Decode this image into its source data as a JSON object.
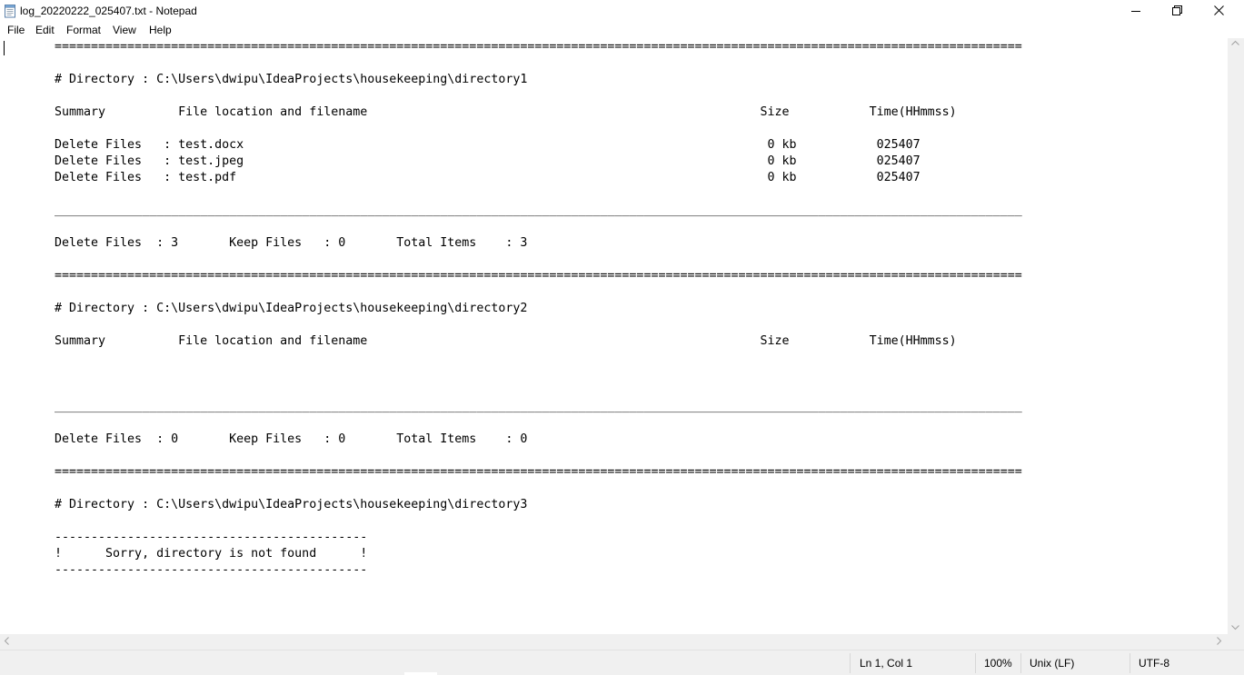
{
  "window": {
    "title": "log_20220222_025407.txt - Notepad",
    "icon": "notepad-icon"
  },
  "menu": [
    "File",
    "Edit",
    "Format",
    "View",
    "Help"
  ],
  "document": {
    "lines": [
      "=====================================================================================================================================",
      "",
      "# Directory : C:\\Users\\dwipu\\IdeaProjects\\housekeeping\\directory1",
      "",
      "Summary          File location and filename                                                      Size           Time(HHmmss)",
      "",
      "Delete Files   : test.docx                                                                        0 kb           025407",
      "Delete Files   : test.jpeg                                                                        0 kb           025407",
      "Delete Files   : test.pdf                                                                         0 kb           025407",
      "",
      "_____________________________________________________________________________________________________________________________________",
      "",
      "Delete Files  : 3       Keep Files   : 0       Total Items    : 3",
      "",
      "=====================================================================================================================================",
      "",
      "# Directory : C:\\Users\\dwipu\\IdeaProjects\\housekeeping\\directory2",
      "",
      "Summary          File location and filename                                                      Size           Time(HHmmss)",
      "",
      "",
      "",
      "_____________________________________________________________________________________________________________________________________",
      "",
      "Delete Files  : 0       Keep Files   : 0       Total Items    : 0",
      "",
      "=====================================================================================================================================",
      "",
      "# Directory : C:\\Users\\dwipu\\IdeaProjects\\housekeeping\\directory3",
      "",
      "-------------------------------------------",
      "!      Sorry, directory is not found      !",
      "-------------------------------------------"
    ]
  },
  "status": {
    "position": "Ln 1, Col 1",
    "zoom": "100%",
    "line_ending": "Unix (LF)",
    "encoding": "UTF-8"
  }
}
